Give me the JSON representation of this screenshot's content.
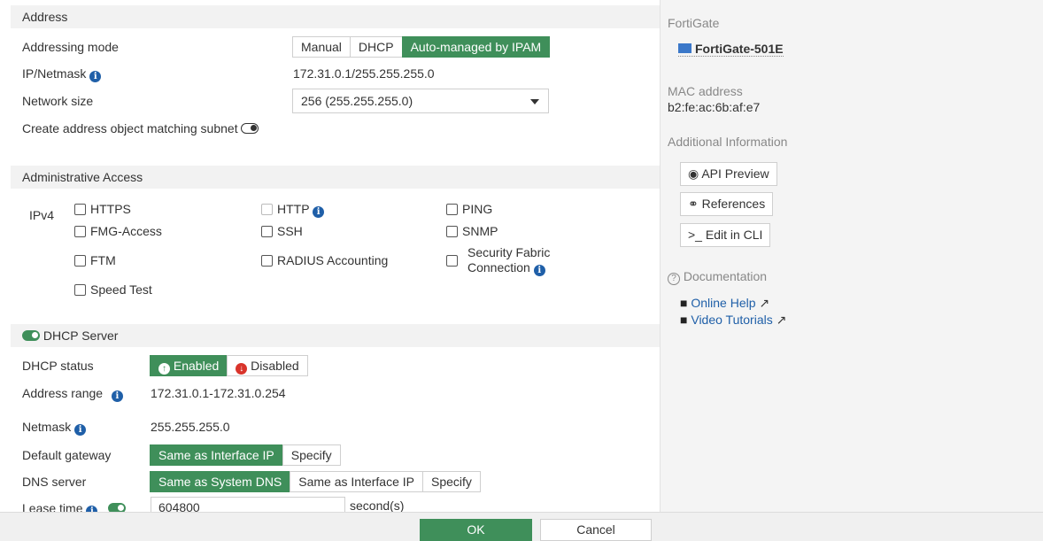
{
  "address": {
    "section_title": "Address",
    "addressing_mode_label": "Addressing mode",
    "addressing_modes": [
      "Manual",
      "DHCP",
      "Auto-managed by IPAM"
    ],
    "ip_netmask_label": "IP/Netmask",
    "ip_netmask_value": "172.31.0.1/255.255.255.0",
    "network_size_label": "Network size",
    "network_size_value": "256 (255.255.255.0)",
    "create_address_object_label": "Create address object matching subnet"
  },
  "admin_access": {
    "section_title": "Administrative Access",
    "ipv4_label": "IPv4",
    "options": {
      "https": "HTTPS",
      "http": "HTTP",
      "ping": "PING",
      "fmg_access": "FMG-Access",
      "ssh": "SSH",
      "snmp": "SNMP",
      "ftm": "FTM",
      "radius_accounting": "RADIUS Accounting",
      "security_fabric_line1": "Security Fabric",
      "security_fabric_line2": "Connection",
      "speed_test": "Speed Test"
    }
  },
  "dhcp": {
    "section_title": "DHCP Server",
    "status_label": "DHCP status",
    "status_enabled": "Enabled",
    "status_disabled": "Disabled",
    "address_range_label": "Address range",
    "address_range_value": "172.31.0.1-172.31.0.254",
    "netmask_label": "Netmask",
    "netmask_value": "255.255.255.0",
    "default_gateway_label": "Default gateway",
    "default_gateway_options": [
      "Same as Interface IP",
      "Specify"
    ],
    "dns_server_label": "DNS server",
    "dns_server_options": [
      "Same as System DNS",
      "Same as Interface IP",
      "Specify"
    ],
    "lease_time_label": "Lease time",
    "lease_time_value": "604800",
    "lease_time_unit": "second(s)"
  },
  "sidebar": {
    "fortigate_label": "FortiGate",
    "device_name": "FortiGate-501E",
    "mac_label": "MAC address",
    "mac_value": "b2:fe:ac:6b:af:e7",
    "additional_info_label": "Additional Information",
    "api_preview": "API Preview",
    "references": "References",
    "edit_in_cli": "Edit in CLI",
    "documentation_label": "Documentation",
    "online_help": "Online Help",
    "video_tutorials": "Video Tutorials"
  },
  "footer": {
    "ok": "OK",
    "cancel": "Cancel"
  },
  "colors": {
    "accent_green": "#3f8f5a",
    "info_blue": "#1f5fa8",
    "disabled_red": "#d9342b"
  }
}
